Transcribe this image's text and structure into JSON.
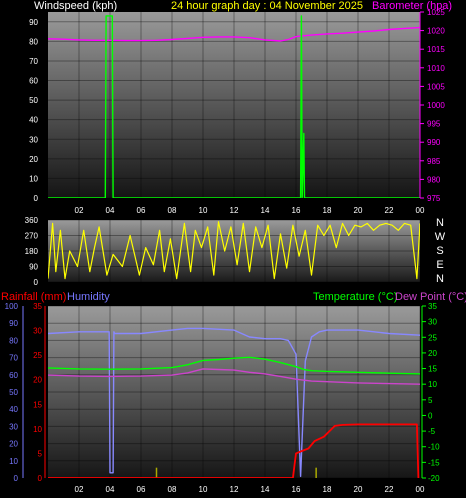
{
  "header": {
    "left_label": "Windspeed (kph)",
    "center_label": "24 hour graph day : 04 November 2025",
    "right_label": "Barometer (hpa)"
  },
  "bottom_header": {
    "rainfall_label": "Rainfall (mm)",
    "humidity_label": "Humidity",
    "temperature_label": "Temperature (°C)",
    "dewpoint_label": "Dew Point (°C)"
  },
  "colors": {
    "wind": "#00ff00",
    "barometer": "#ff00ff",
    "direction": "#ffff00",
    "rain": "#ff0000",
    "humidity": "#8888ff",
    "temperature": "#00ff00",
    "dewpoint": "#cc44cc",
    "rain_bars": "#aaaa00",
    "temp_axis": "#00ff00",
    "humidity_axis": "#7777ff"
  },
  "chart_data": [
    {
      "type": "line",
      "x_ticks": [
        "02",
        "04",
        "06",
        "08",
        "10",
        "12",
        "14",
        "16",
        "18",
        "20",
        "22",
        "00"
      ],
      "y_left": {
        "label": "Windspeed (kph)",
        "ticks": [
          "0",
          "10",
          "20",
          "30",
          "40",
          "50",
          "60",
          "70",
          "80",
          "90"
        ],
        "ylim": [
          0,
          95
        ]
      },
      "y_right": {
        "label": "Barometer (hpa)",
        "ticks": [
          "975",
          "980",
          "985",
          "990",
          "995",
          "1000",
          "1005",
          "1010",
          "1015",
          "1020",
          "1025"
        ],
        "ylim": [
          975,
          1025
        ]
      },
      "series": [
        {
          "name": "Barometer",
          "x": [
            0,
            1,
            2,
            3,
            4,
            5,
            6,
            7,
            8,
            9,
            10,
            11,
            12,
            13,
            14,
            15,
            15.5,
            16,
            17,
            18,
            19,
            20,
            21,
            22,
            23,
            24
          ],
          "values": [
            1017.8,
            1017.7,
            1017.5,
            1017.4,
            1017.4,
            1017.3,
            1017.3,
            1017.4,
            1017.6,
            1017.9,
            1018.2,
            1018.3,
            1018.3,
            1018.1,
            1017.5,
            1017.2,
            1017.6,
            1018.4,
            1018.8,
            1019.1,
            1019.3,
            1019.6,
            1019.9,
            1020.3,
            1020.6,
            1020.8
          ]
        },
        {
          "name": "Windspeed",
          "x": [
            0,
            3.7,
            3.75,
            4.15,
            4.2,
            16.3,
            16.35,
            16.4,
            16.5,
            16.55,
            24
          ],
          "values": [
            0,
            0,
            93,
            93,
            0,
            0,
            93,
            0,
            33,
            0,
            0
          ]
        }
      ]
    },
    {
      "type": "line",
      "y_ticks": [
        "0",
        "90",
        "180",
        "270",
        "360"
      ],
      "ylim": [
        0,
        360
      ],
      "directions": [
        "N",
        "W",
        "S",
        "E",
        "N"
      ],
      "series": [
        {
          "name": "Wind direction",
          "x": [
            0,
            0.3,
            0.5,
            0.8,
            1.1,
            1.4,
            1.9,
            2.3,
            2.7,
            3.0,
            3.3,
            3.8,
            4.2,
            4.8,
            5.3,
            5.9,
            6.3,
            6.8,
            7.2,
            7.5,
            7.9,
            8.3,
            8.8,
            9.2,
            9.5,
            9.9,
            10.3,
            10.7,
            11.0,
            11.4,
            11.8,
            12.2,
            12.6,
            13.0,
            13.4,
            13.8,
            14.2,
            14.6,
            15.0,
            15.4,
            15.8,
            16.2,
            16.6,
            17.0,
            17.4,
            17.8,
            18.2,
            18.6,
            19.0,
            19.4,
            19.8,
            20.2,
            20.6,
            21.0,
            21.4,
            21.8,
            22.2,
            22.6,
            23.0,
            23.4,
            23.8,
            24
          ],
          "values": [
            20,
            340,
            60,
            300,
            20,
            180,
            90,
            300,
            60,
            200,
            320,
            40,
            160,
            90,
            270,
            40,
            200,
            100,
            300,
            60,
            250,
            20,
            340,
            60,
            300,
            200,
            320,
            40,
            350,
            180,
            320,
            100,
            340,
            60,
            320,
            200,
            330,
            20,
            280,
            80,
            330,
            150,
            300,
            40,
            330,
            270,
            330,
            200,
            340,
            270,
            330,
            320,
            340,
            300,
            330,
            340,
            330,
            300,
            340,
            330,
            20,
            340
          ]
        }
      ]
    },
    {
      "type": "line",
      "x_ticks": [
        "02",
        "04",
        "06",
        "08",
        "10",
        "12",
        "14",
        "16",
        "18",
        "20",
        "22",
        "00"
      ],
      "y_humidity": {
        "label": "Humidity",
        "ticks": [
          "0",
          "10",
          "20",
          "30",
          "40",
          "50",
          "60",
          "70",
          "80",
          "90",
          "100"
        ],
        "ylim": [
          0,
          100
        ]
      },
      "y_rainfall": {
        "label": "Rainfall (mm)",
        "ticks": [
          "0",
          "5",
          "10",
          "15",
          "20",
          "25",
          "30",
          "35"
        ],
        "ylim": [
          0,
          35
        ]
      },
      "y_temperature": {
        "label": "Temperature (°C)",
        "ticks": [
          "-20",
          "-15",
          "-10",
          "-5",
          "0",
          "5",
          "10",
          "15",
          "20",
          "25",
          "30",
          "35"
        ],
        "ylim": [
          -20,
          35
        ]
      },
      "series": [
        {
          "name": "Humidity",
          "x": [
            0,
            2,
            3.5,
            3.95,
            4.0,
            4.1,
            4.2,
            4.25,
            4.3,
            6,
            8,
            9,
            10,
            12,
            13,
            14,
            15,
            15.5,
            16,
            16.3,
            16.6,
            17,
            17.5,
            18,
            20,
            22,
            24
          ],
          "values": [
            84,
            85,
            85,
            85,
            3,
            3,
            3,
            85,
            84,
            84,
            86,
            87,
            87,
            86,
            82,
            81,
            81,
            80,
            72,
            1,
            68,
            82,
            85,
            86,
            86,
            84,
            83
          ]
        },
        {
          "name": "Temperature",
          "x": [
            0,
            2,
            4,
            6,
            8,
            9,
            10,
            11,
            12,
            13,
            14,
            15,
            16,
            16.5,
            17,
            18,
            20,
            22,
            24
          ],
          "values": [
            15.2,
            14.9,
            14.8,
            14.9,
            15.3,
            16.2,
            17.6,
            17.9,
            18.3,
            18.6,
            18.0,
            16.9,
            15.6,
            14.7,
            14.3,
            14.1,
            13.8,
            13.5,
            13.3
          ]
        },
        {
          "name": "Dew Point",
          "x": [
            0,
            2,
            4,
            6,
            8,
            9,
            10,
            11,
            12,
            13,
            14,
            15,
            16,
            17,
            18,
            20,
            22,
            24
          ],
          "values": [
            12.9,
            12.6,
            12.5,
            12.6,
            12.9,
            13.6,
            14.9,
            14.7,
            14.5,
            13.8,
            13.3,
            12.5,
            11.6,
            11.0,
            10.8,
            10.4,
            10.2,
            10.0
          ]
        },
        {
          "name": "Rainfall",
          "x": [
            0,
            15.8,
            16.0,
            16.3,
            16.8,
            17.2,
            17.8,
            18.5,
            19.0,
            20,
            22,
            23.8,
            23.9
          ],
          "values": [
            0,
            0,
            5.0,
            5.4,
            6.0,
            7.5,
            8.4,
            10.6,
            10.8,
            10.9,
            10.9,
            10.9,
            0
          ]
        },
        {
          "name": "Rain rate",
          "x": [
            7.0,
            17.3
          ],
          "values": [
            2.1,
            2.1
          ]
        }
      ]
    }
  ]
}
